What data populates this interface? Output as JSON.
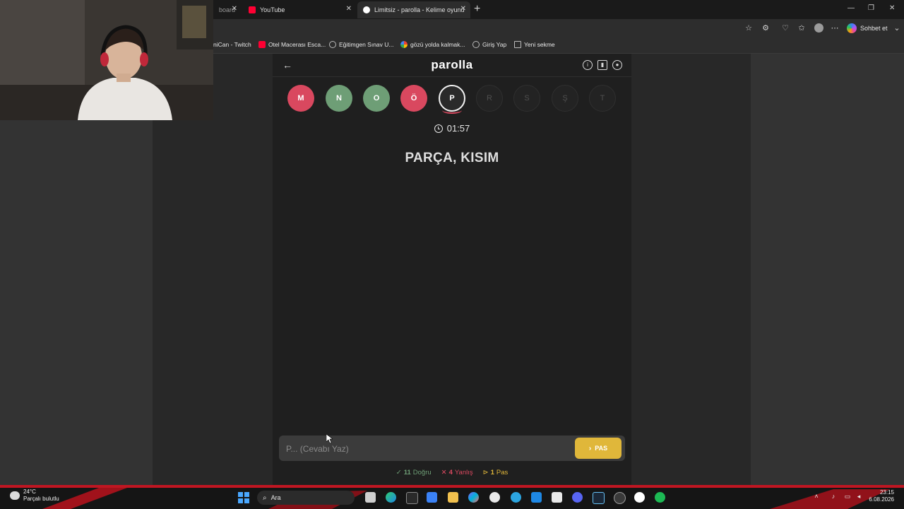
{
  "browser": {
    "tabs": [
      {
        "title": "board",
        "icon_color": "#6b6b6b"
      },
      {
        "title": "YouTube",
        "icon_color": "#ff0033"
      },
      {
        "title": "Limitsiz - parolla - Kelime oyunu",
        "icon_color": "#ffffff",
        "active": true
      }
    ],
    "copilot_label": "Sohbet et",
    "bookmarks": [
      {
        "label": "niCan - Twitch",
        "icon_color": "#9146ff"
      },
      {
        "label": "Otel Macerası Esca...",
        "icon_color": "#ff0033"
      },
      {
        "label": "Eğitimgen Sınav U...",
        "icon_color": "#bbbbbb"
      },
      {
        "label": "gözü yolda kalmak...",
        "icon_color": "#fbbc05"
      },
      {
        "label": "Giriş Yap",
        "icon_color": "#bbbbbb"
      },
      {
        "label": "Yeni sekme",
        "icon_color": "#bbbbbb"
      }
    ]
  },
  "game": {
    "logo": "parolla",
    "letters": [
      {
        "letter": "M",
        "state": "wrong"
      },
      {
        "letter": "N",
        "state": "correct"
      },
      {
        "letter": "O",
        "state": "correct"
      },
      {
        "letter": "Ö",
        "state": "wrong"
      },
      {
        "letter": "P",
        "state": "current"
      },
      {
        "letter": "R",
        "state": "pending"
      },
      {
        "letter": "S",
        "state": "pending"
      },
      {
        "letter": "Ş",
        "state": "pending"
      },
      {
        "letter": "T",
        "state": "pending"
      }
    ],
    "timer": "01:57",
    "clue": "PARÇA, KISIM",
    "input_placeholder": "P... (Cevabı Yaz)",
    "pass_label": "PAS",
    "score": {
      "correct_count": "11",
      "correct_label": "Doğru",
      "wrong_count": "4",
      "wrong_label": "Yanlış",
      "pass_count": "1",
      "pass_label": "Pas"
    },
    "colors": {
      "correct": "#6e9e76",
      "wrong": "#d9485f",
      "pass": "#e0b73a"
    }
  },
  "taskbar": {
    "weather_temp": "24°C",
    "weather_desc": "Parçalı bulutlu",
    "search_label": "Ara",
    "time": "23:15",
    "date": "6.08.2026"
  }
}
